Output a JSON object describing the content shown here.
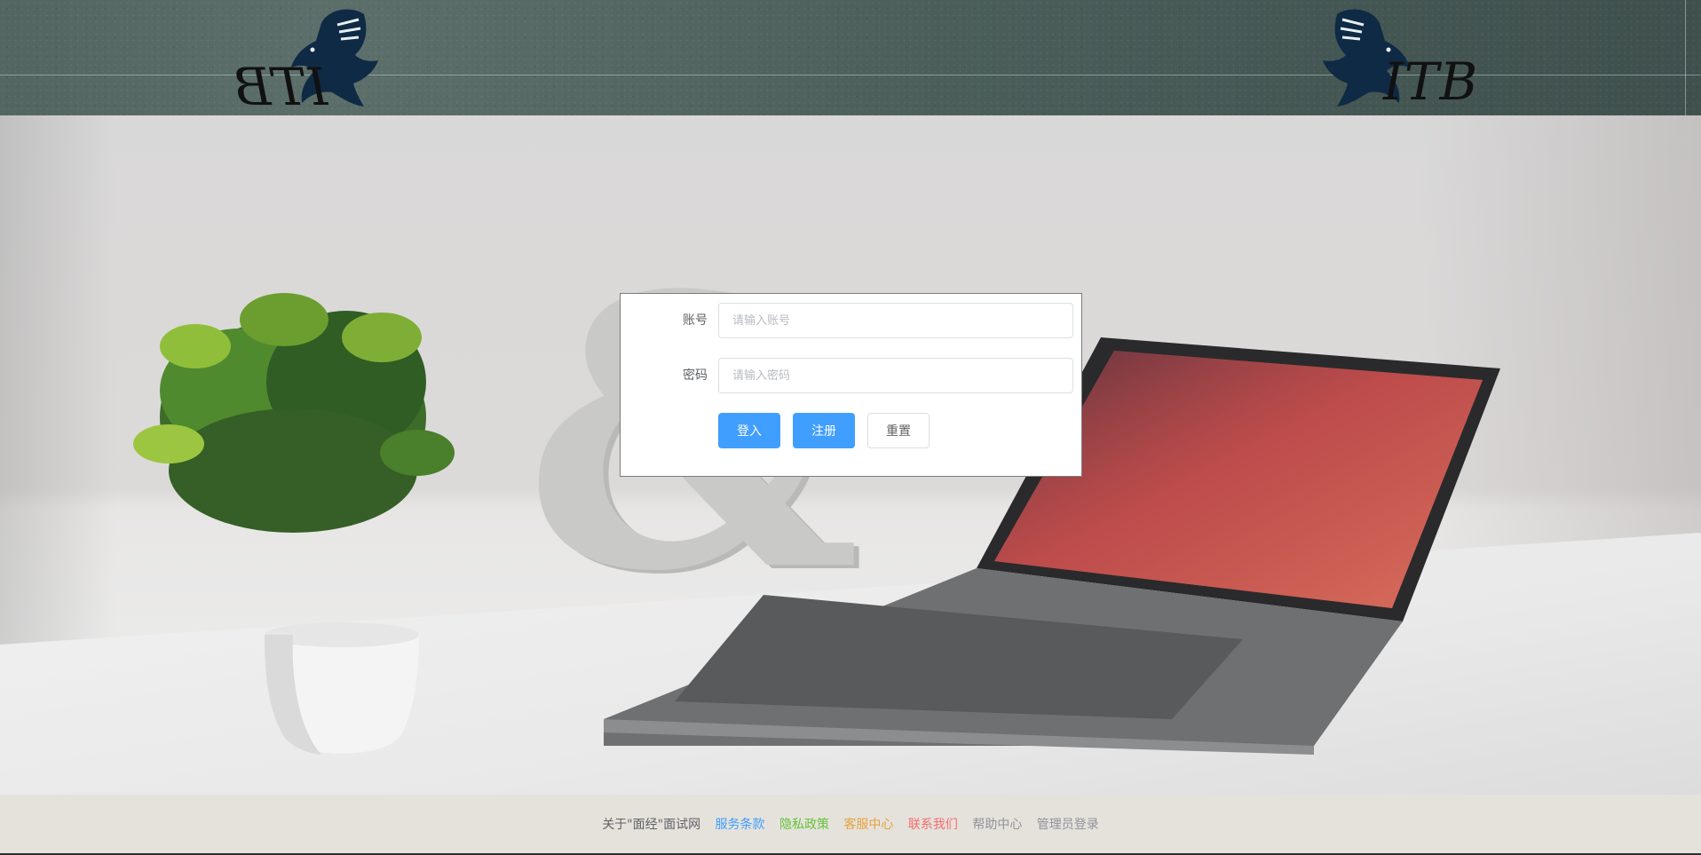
{
  "header": {
    "logo_left_text": "ITB",
    "logo_right_text": "ITB"
  },
  "login": {
    "account_label": "账号",
    "account_placeholder": "请输入账号",
    "account_value": "",
    "password_label": "密码",
    "password_placeholder": "请输入密码",
    "password_value": "",
    "login_button": "登入",
    "register_button": "注册",
    "reset_button": "重置"
  },
  "footer": {
    "links": [
      {
        "label": "关于\"面经\"面试网",
        "color": "#606266"
      },
      {
        "label": "服务条款",
        "color": "#409eff"
      },
      {
        "label": "隐私政策",
        "color": "#67c23a"
      },
      {
        "label": "客服中心",
        "color": "#e6a23c"
      },
      {
        "label": "联系我们",
        "color": "#f56c6c"
      },
      {
        "label": "帮助中心",
        "color": "#909399"
      },
      {
        "label": "管理员登录",
        "color": "#909399"
      }
    ]
  },
  "colors": {
    "primary": "#409eff",
    "header_bg": "#4b5e5a",
    "eagle": "#0f2a45"
  }
}
